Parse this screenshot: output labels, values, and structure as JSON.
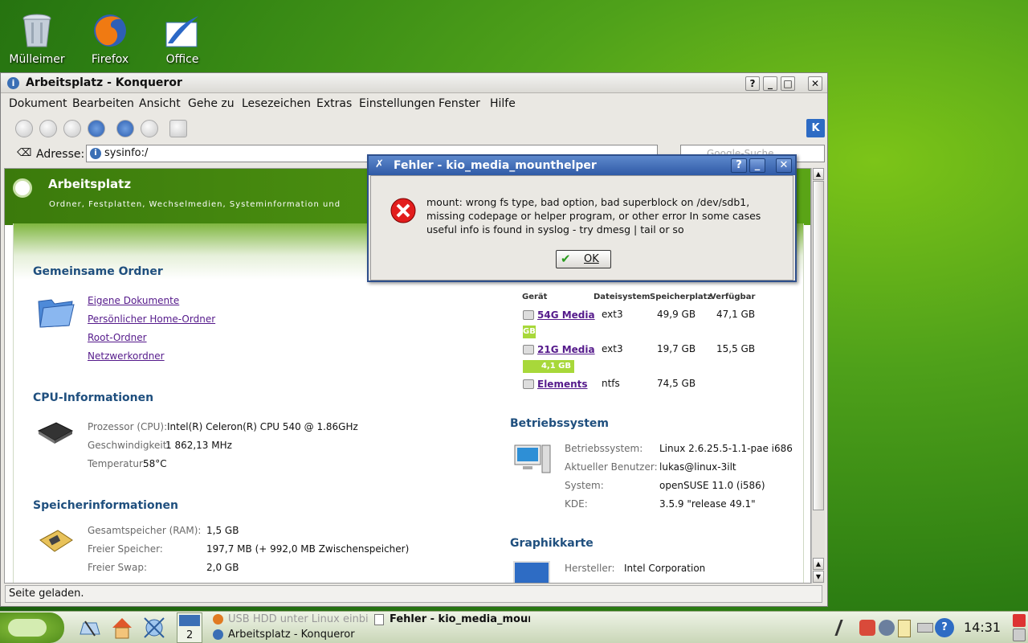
{
  "desktop": {
    "icons": [
      {
        "label": "Mülleimer",
        "icon": "trash-icon"
      },
      {
        "label": "Firefox",
        "icon": "firefox-icon"
      },
      {
        "label": "Office",
        "icon": "office-icon"
      }
    ]
  },
  "window": {
    "title": "Arbeitsplatz - Konqueror",
    "menu": [
      "Dokument",
      "Bearbeiten",
      "Ansicht",
      "Gehe zu",
      "Lesezeichen",
      "Extras",
      "Einstellungen",
      "Fenster",
      "Hilfe"
    ],
    "address_label": "Adresse:",
    "address_value": "sysinfo:/",
    "search_placeholder": "Google-Suche",
    "status": "Seite geladen."
  },
  "page": {
    "title": "Arbeitsplatz",
    "subtitle": "Ordner, Festplatten, Wechselmedien, Systeminformation und",
    "folders": {
      "heading": "Gemeinsame Ordner",
      "links": [
        "Eigene Dokumente",
        "Persönlicher Home-Ordner",
        "Root-Ordner",
        "Netzwerkordner"
      ]
    },
    "cpu": {
      "heading": "CPU-Informationen",
      "rows": [
        {
          "label": "Prozessor (CPU):",
          "value": "Intel(R) Celeron(R) CPU 540 @ 1.86GHz"
        },
        {
          "label": "Geschwindigkeit:",
          "value": "1 862,13 MHz"
        },
        {
          "label": "Temperatur:",
          "value": "58°C"
        }
      ]
    },
    "memory": {
      "heading": "Speicherinformationen",
      "rows": [
        {
          "label": "Gesamtspeicher (RAM):",
          "value": "1,5 GB"
        },
        {
          "label": "Freier Speicher:",
          "value": "197,7 MB (+ 992,0 MB Zwischenspeicher)"
        },
        {
          "label": "Freier Swap:",
          "value": "2,0 GB"
        }
      ]
    },
    "disks": {
      "headers": [
        "Gerät",
        "Dateisystem",
        "Speicherplatz",
        "Verfügbar"
      ],
      "rows": [
        {
          "device": "54G Media",
          "fs": "ext3",
          "size": "49,9 GB",
          "free": "47,1 GB",
          "bar_label": "GB"
        },
        {
          "device": "21G Media",
          "fs": "ext3",
          "size": "19,7 GB",
          "free": "15,5 GB",
          "bar_label": "4,1 GB"
        },
        {
          "device": "Elements",
          "fs": "ntfs",
          "size": "74,5 GB",
          "free": ""
        }
      ]
    },
    "os": {
      "heading": "Betriebssystem",
      "rows": [
        {
          "label": "Betriebssystem:",
          "value": "Linux 2.6.25.5-1.1-pae i686"
        },
        {
          "label": "Aktueller Benutzer:",
          "value": "lukas@linux-3ilt"
        },
        {
          "label": "System:",
          "value": "openSUSE 11.0 (i586)"
        },
        {
          "label": "KDE:",
          "value": "3.5.9 \"release 49.1\""
        }
      ]
    },
    "gpu": {
      "heading": "Graphikkarte",
      "rows": [
        {
          "label": "Hersteller:",
          "value": "Intel Corporation"
        }
      ]
    }
  },
  "dialog": {
    "title": "Fehler - kio_media_mounthelper",
    "message": [
      "mount: wrong fs type, bad option, bad superblock on /dev/sdb1,",
      "missing codepage or helper program, or other error In some cases",
      "useful info is found in syslog - try dmesg | tail or so"
    ],
    "ok_label": "OK"
  },
  "taskbar": {
    "desktop_number": "2",
    "tasks": [
      {
        "label": "USB HDD unter Linux einbi"
      },
      {
        "label": "Fehler - kio_media_moun"
      },
      {
        "label": "Arbeitsplatz - Konqueror"
      }
    ],
    "clock": "14:31"
  },
  "colors": {
    "accent": "#2f5aa6",
    "heading": "#1f4f7e",
    "bar": "#a8d83a"
  }
}
